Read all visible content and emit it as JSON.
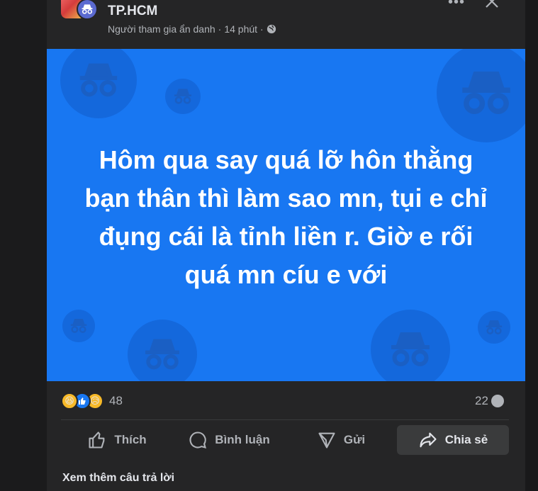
{
  "post": {
    "group_name": "TP.HCM",
    "author": "Người tham gia ẩn danh",
    "separator": "·",
    "time": "14 phút",
    "privacy_icon": "globe-icon"
  },
  "banner": {
    "text": "Hôm qua say quá lỡ hôn thằng bạn thân thì làm sao mn, tụi e chỉ đụng cái là tỉnh liền r. Giờ e rối quá mn cíu e với",
    "bg_color": "#1877f2"
  },
  "stats": {
    "reaction_icons": [
      "haha-icon",
      "like-icon",
      "sad-icon"
    ],
    "reaction_count": "48",
    "comment_count": "22"
  },
  "actions": [
    {
      "label": "Thích",
      "icon": "thumbs-up-icon"
    },
    {
      "label": "Bình luận",
      "icon": "comment-icon"
    },
    {
      "label": "Gửi",
      "icon": "send-icon"
    },
    {
      "label": "Chia sẻ",
      "icon": "share-icon"
    }
  ],
  "footer": {
    "see_more": "Xem thêm câu trả lời"
  }
}
